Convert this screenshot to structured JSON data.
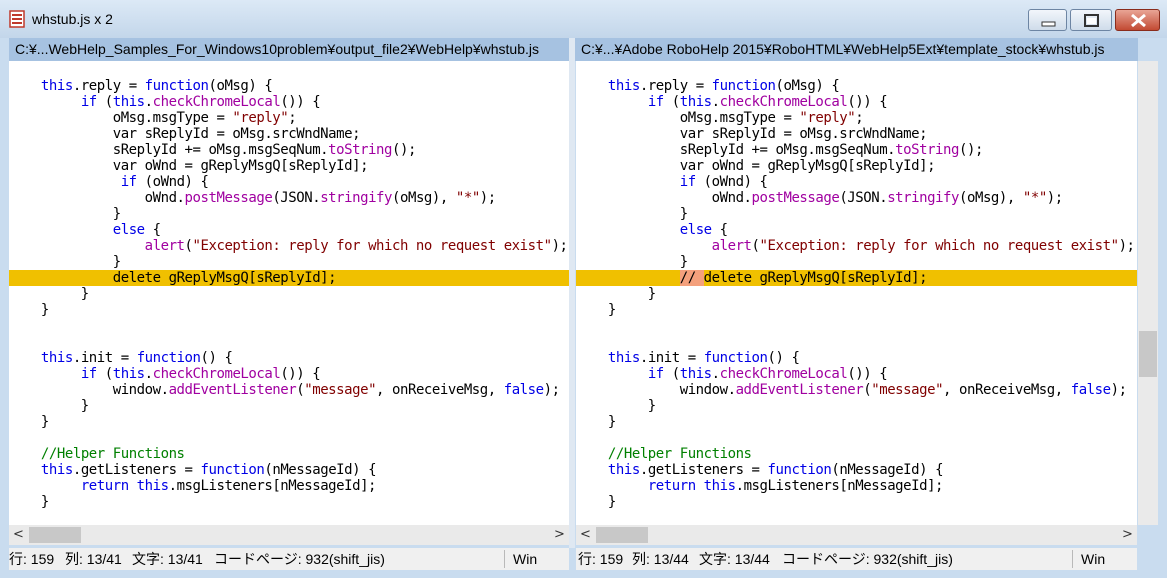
{
  "window": {
    "title": "whstub.js x 2",
    "icons": {
      "app": "document-diff-icon",
      "minimize": "minimize-icon",
      "maximize": "maximize-icon",
      "close": "close-icon"
    }
  },
  "panes": {
    "left": {
      "path": "C:¥...WebHelp_Samples_For_Windows10problem¥output_file2¥WebHelp¥whstub.js",
      "status": {
        "line": "行: 159",
        "col": "列: 13/41",
        "char": "文字: 13/41",
        "codepage": "コードページ: 932(shift_jis)",
        "eol": "Win"
      }
    },
    "right": {
      "path": "C:¥...¥Adobe RoboHelp 2015¥RoboHTML¥WebHelp5Ext¥template_stock¥whstub.js",
      "status": {
        "line": "行: 159",
        "col": "列: 13/44",
        "char": "文字: 13/44",
        "codepage": "コードページ: 932(shift_jis)",
        "eol": "Win"
      }
    }
  },
  "code": {
    "reply_line": "this.reply = function(oMsg) {",
    "if_chrome": "if (this.checkChromeLocal()) {",
    "msgtype": "oMsg.msgType = \"reply\";",
    "sreplyid": "var sReplyId = oMsg.srcWndName;",
    "sreplyid_add": "sReplyId += oMsg.msgSeqNum.toString();",
    "ownd": "var oWnd = gReplyMsgQ[sReplyId];",
    "if_ownd": "if (oWnd) {",
    "postmessage": "oWnd.postMessage(JSON.stringify(oMsg), \"*\");",
    "close_brace": "}",
    "else_line": "else {",
    "alert_line": "alert(\"Exception: reply for which no request exist\");",
    "delete_left": "delete gReplyMsgQ[sReplyId];",
    "delete_right_prefix": "// ",
    "delete_right": "delete gReplyMsgQ[sReplyId];",
    "init_line": "this.init = function() {",
    "add_listener": "window.addEventListener(\"message\", onReceiveMsg, false);",
    "helper_comment": "//Helper Functions",
    "getlisteners": "this.getListeners = function(nMessageId) {",
    "return_line": "return this.msgListeners[nMessageId];"
  },
  "colors": {
    "highlight": "#f0c000",
    "diff": "#f4a07c",
    "keyword": "#0000e6",
    "function": "#a000a0",
    "string": "#800000",
    "comment": "#008000"
  }
}
